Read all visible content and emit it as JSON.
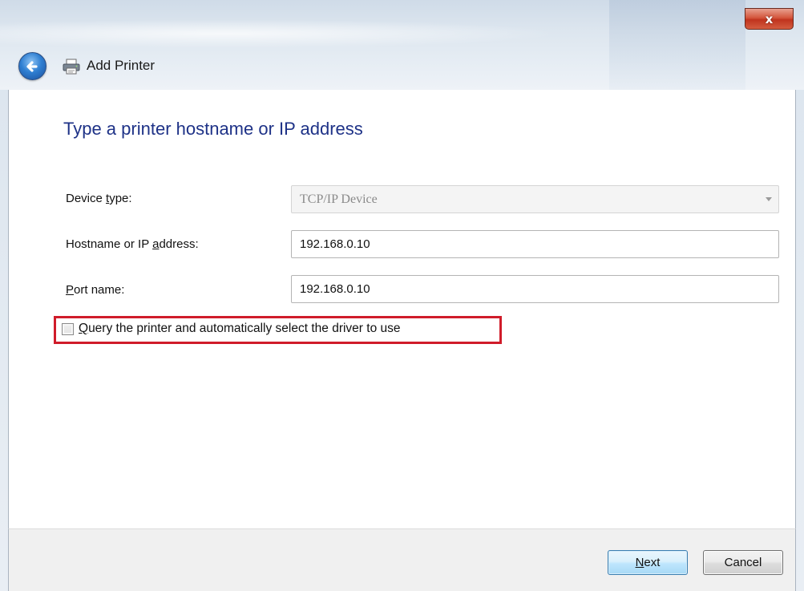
{
  "window": {
    "title": "Add Printer",
    "close_glyph": "x"
  },
  "page": {
    "title": "Type a printer hostname or IP address"
  },
  "form": {
    "device_type": {
      "label_pre": "Device ",
      "label_accel": "t",
      "label_post": "ype:",
      "value": "TCP/IP Device"
    },
    "hostname": {
      "label_pre": "Hostname or IP ",
      "label_accel": "a",
      "label_post": "ddress:",
      "value": "192.168.0.10"
    },
    "port": {
      "label_pre": "",
      "label_accel": "P",
      "label_post": "ort name:",
      "value": "192.168.0.10"
    },
    "query_checkbox": {
      "label_pre": "",
      "label_accel": "Q",
      "label_post": "uery the printer and automatically select the driver to use",
      "checked": false
    }
  },
  "footer": {
    "next": {
      "accel": "N",
      "rest": "ext"
    },
    "cancel": {
      "label": "Cancel"
    }
  },
  "icons": {
    "back": "back-arrow-icon",
    "printer": "printer-icon",
    "close": "close-icon",
    "dropdown": "chevron-down-icon"
  },
  "colors": {
    "page_title": "#1e3287",
    "highlight": "#d01c2a",
    "close_button": "#c0341e"
  }
}
